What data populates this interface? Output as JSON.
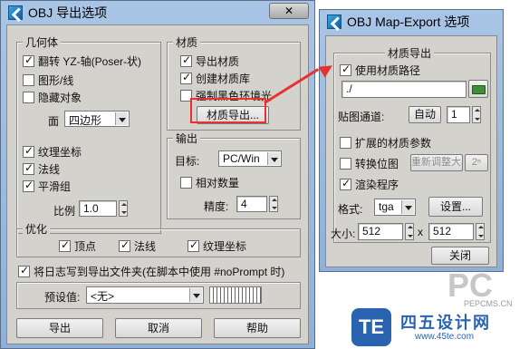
{
  "main": {
    "title": "OBJ 导出选项",
    "close_label": "✕",
    "geometry": {
      "title": "几何体",
      "flip_yz": "翻转 YZ-轴(Poser-状)",
      "shapes": "图形/线",
      "hidden": "隐藏对象",
      "faces_label": "面",
      "faces_value": "四边形",
      "texcoords": "纹理坐标",
      "normals": "法线",
      "smoothing": "平滑组",
      "scale_label": "比例",
      "scale_value": "1.0"
    },
    "material": {
      "title": "材质",
      "export_mat": "导出材质",
      "create_lib": "创建材质库",
      "force_black": "强制黑色环境光",
      "mat_export_btn": "材质导出..."
    },
    "output": {
      "title": "输出",
      "target_label": "目标:",
      "target_value": "PC/Win",
      "relative": "相对数量",
      "precision_label": "精度:",
      "precision_value": "4"
    },
    "optimize": {
      "title": "优化",
      "vertices": "顶点",
      "normals": "法线",
      "texcoords": "纹理坐标"
    },
    "log_text": "将日志写到导出文件夹(在脚本中使用 #noPrompt 时)",
    "preset_label": "预设值:",
    "preset_value": "<无>",
    "buttons": {
      "export": "导出",
      "cancel": "取消",
      "help": "帮助"
    }
  },
  "map_export": {
    "title": "OBJ Map-Export 选项",
    "group_title": "材质导出",
    "use_path": "使用材质路径",
    "path_value": "./",
    "channel_label": "贴图通道:",
    "auto_btn": "自动",
    "channel_value": "1",
    "extended": "扩展的材质参数",
    "convert": "转换位图",
    "resize_btn": "重新调整大小",
    "pow2_btn": "2ⁿ",
    "render": "渲染程序",
    "format_label": "格式:",
    "format_value": "tga",
    "settings_btn": "设置...",
    "size_label": "大小:",
    "size_w": "512",
    "size_x": "x",
    "size_h": "512",
    "close_btn": "关闭"
  },
  "watermarks": {
    "pc_text": "PC",
    "pc_url": "PEPCMS.CN",
    "te_logo": "TE",
    "te_name": "四五设计网",
    "te_url": "www.45te.com"
  },
  "colors": {
    "annotation_red": "#e8322d",
    "dialog_bg": "#d4d2cc",
    "titlebar": "#9fbde2"
  }
}
